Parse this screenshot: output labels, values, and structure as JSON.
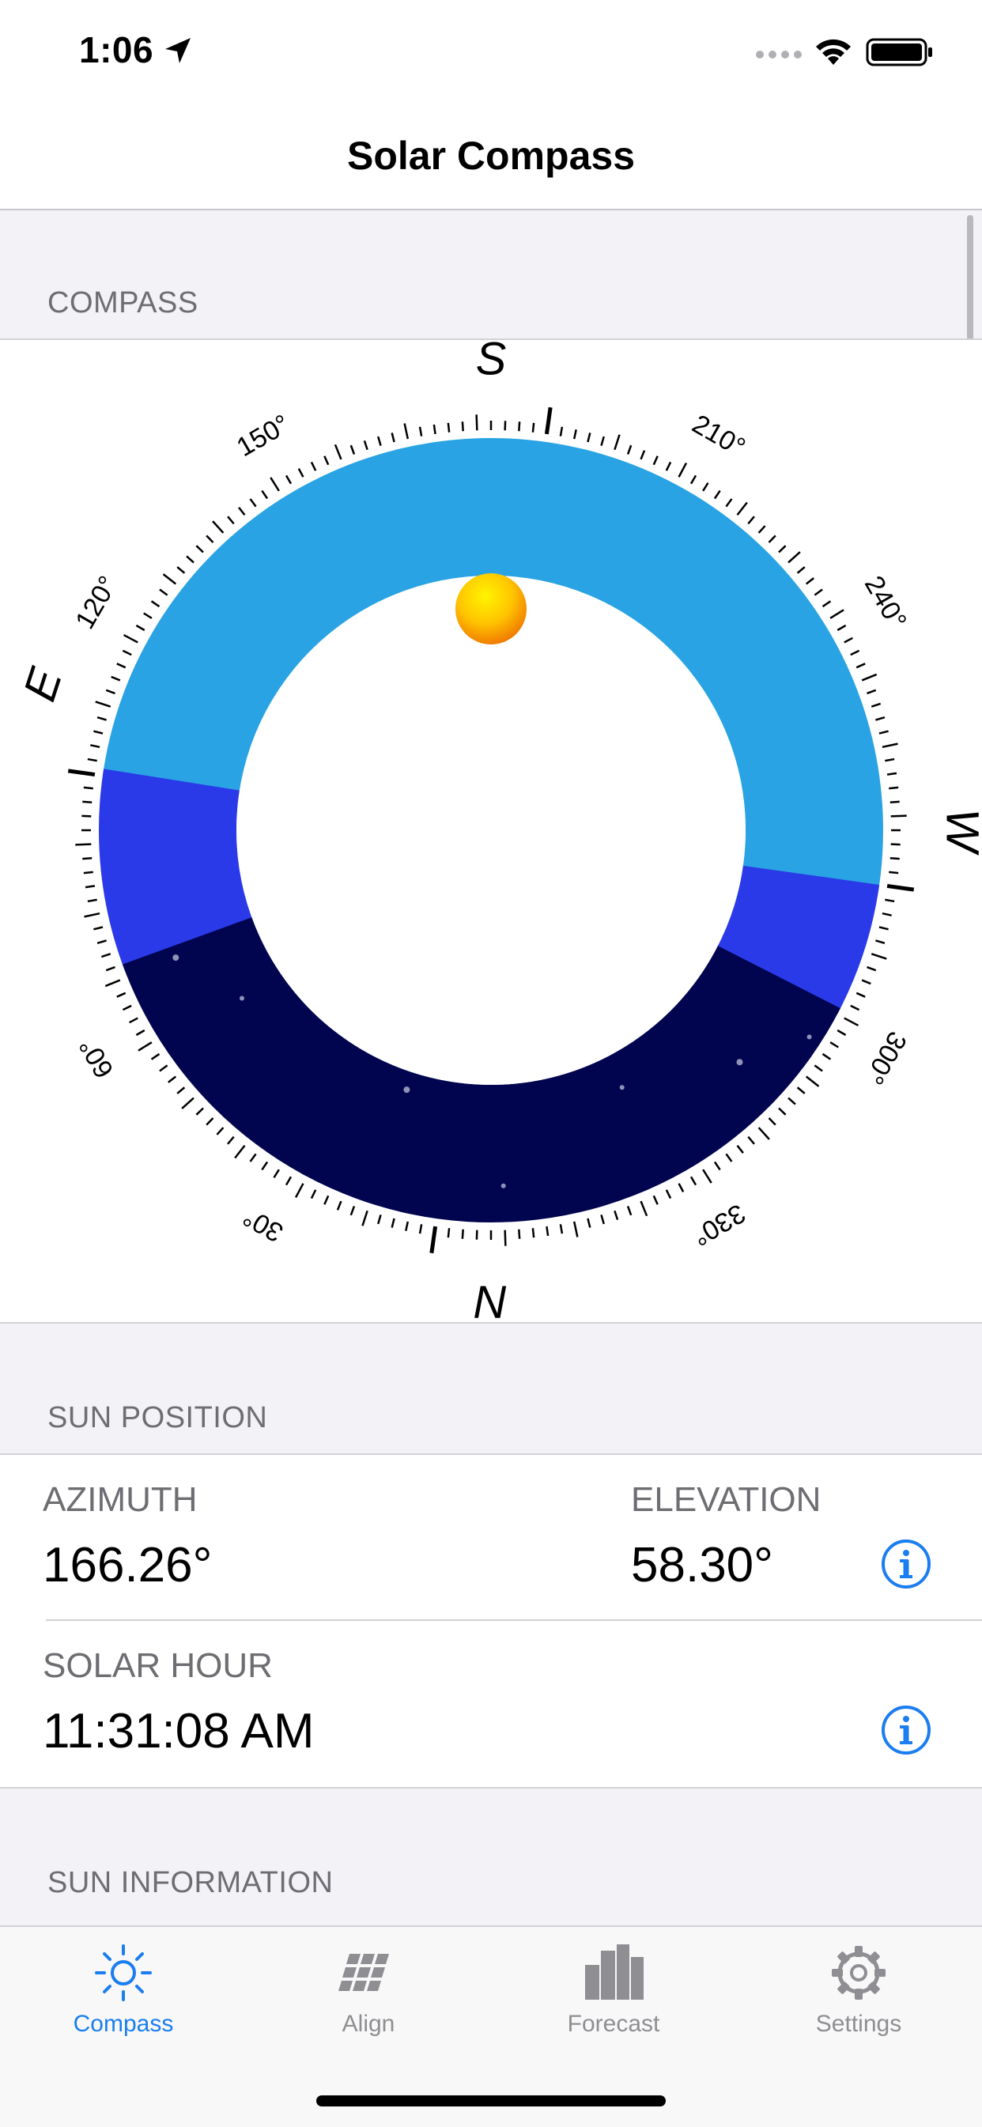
{
  "status_bar": {
    "time": "1:06",
    "icons": [
      "location-arrow-icon",
      "cellular-signal-icon",
      "wifi-icon",
      "battery-icon"
    ]
  },
  "nav": {
    "title": "Solar Compass"
  },
  "compass_section": {
    "header": "COMPASS",
    "cardinals": {
      "north": "N",
      "east": "E",
      "south": "S",
      "west": "W"
    },
    "degree_labels": [
      "30°",
      "60°",
      "120°",
      "150°",
      "210°",
      "240°",
      "300°",
      "330°"
    ],
    "colors": {
      "day_sky": "#29a3e3",
      "twilight": "#2b3ae8",
      "night": "#01054f",
      "sun": "#ffd000"
    }
  },
  "sun_position": {
    "header": "SUN POSITION",
    "azimuth_label": "AZIMUTH",
    "azimuth_value": "166.26°",
    "elevation_label": "ELEVATION",
    "elevation_value": "58.30°",
    "solar_hour_label": "SOLAR HOUR",
    "solar_hour_value": "11:31:08 AM"
  },
  "sun_information": {
    "header": "SUN INFORMATION"
  },
  "tabs": [
    {
      "label": "Compass",
      "icon": "sun-icon",
      "active": true
    },
    {
      "label": "Align",
      "icon": "solar-panel-icon",
      "active": false
    },
    {
      "label": "Forecast",
      "icon": "bar-chart-icon",
      "active": false
    },
    {
      "label": "Settings",
      "icon": "gear-icon",
      "active": false
    }
  ],
  "accent_color": "#1a7df0"
}
